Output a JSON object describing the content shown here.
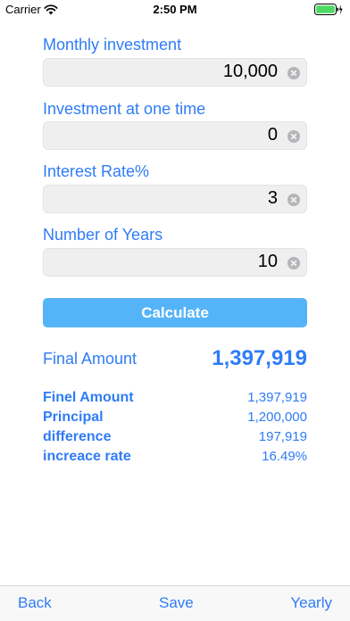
{
  "status_bar": {
    "carrier": "Carrier",
    "time": "2:50 PM",
    "battery_color": "#4cd964"
  },
  "form": {
    "fields": [
      {
        "label": "Monthly investment",
        "value": "10,000"
      },
      {
        "label": "Investment at one time",
        "value": "0"
      },
      {
        "label": "Interest Rate%",
        "value": "3"
      },
      {
        "label": "Number of Years",
        "value": "10"
      }
    ],
    "calculate_label": "Calculate"
  },
  "final": {
    "label": "Final Amount",
    "value": "1,397,919"
  },
  "results": [
    {
      "label": "Finel Amount",
      "value": "1,397,919"
    },
    {
      "label": "Principal",
      "value": "1,200,000"
    },
    {
      "label": "difference",
      "value": "197,919"
    },
    {
      "label": "increace rate",
      "value": "16.49%"
    }
  ],
  "toolbar": {
    "back_label": "Back",
    "save_label": "Save",
    "yearly_label": "Yearly"
  },
  "colors": {
    "accent": "#2f7cf6",
    "button": "#55b4f7",
    "field_background": "#efefef"
  }
}
